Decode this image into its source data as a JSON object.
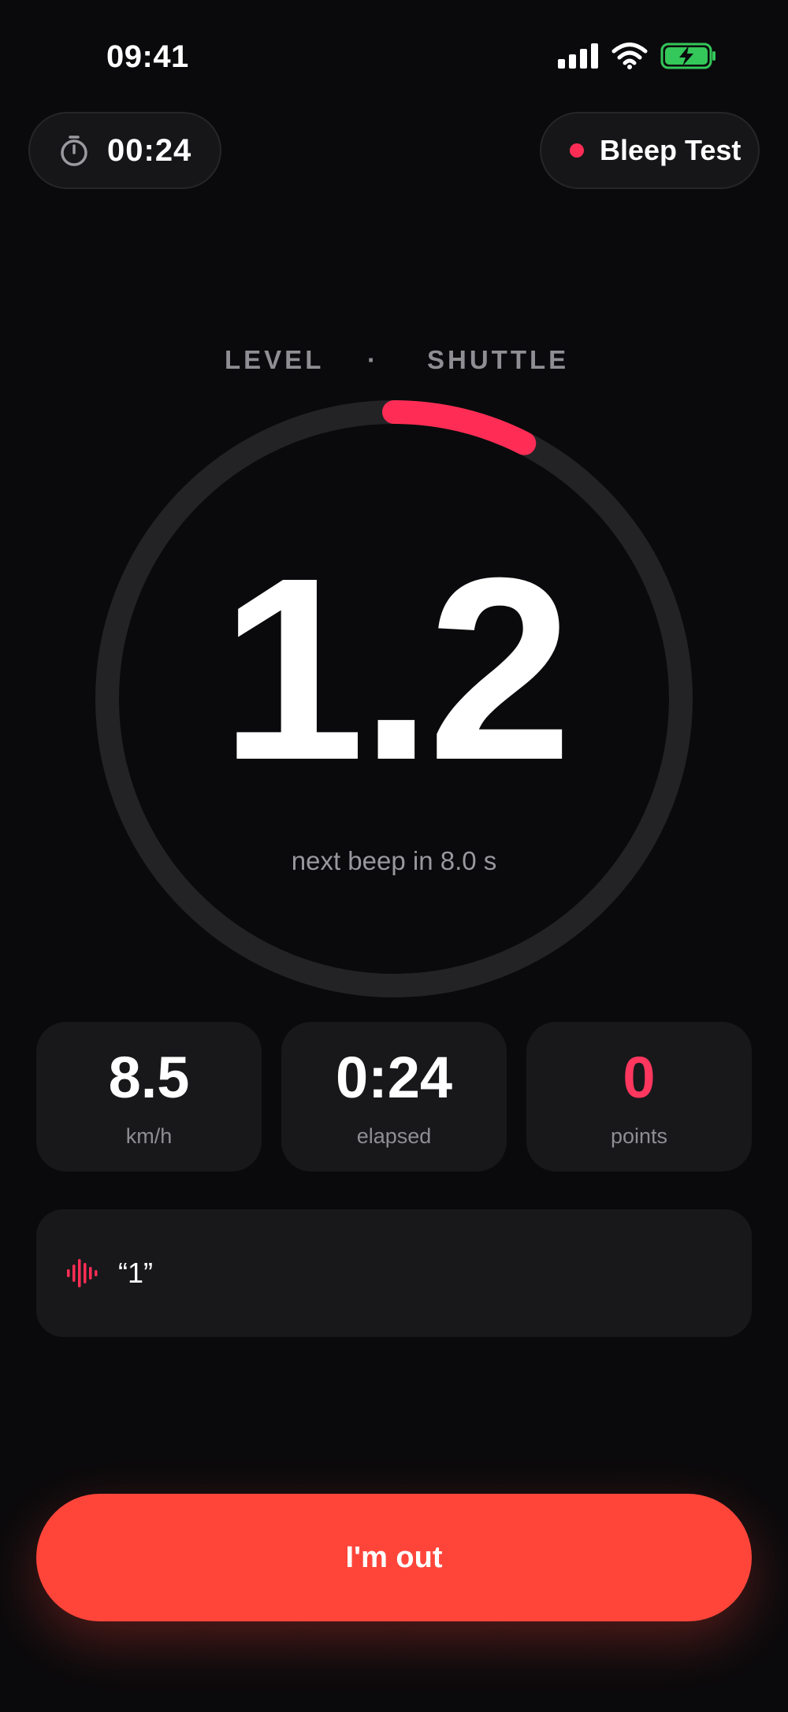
{
  "status_bar": {
    "time": "09:41"
  },
  "header": {
    "timer_value": "00:24",
    "mode_label": "Bleep Test"
  },
  "progress": {
    "level_label": "LEVEL",
    "separator": "·",
    "shuttle_label": "SHUTTLE",
    "value": "1.2",
    "next_beep_text": "next beep in 8.0 s",
    "ring_fraction": 0.075
  },
  "stats": [
    {
      "value": "8.5",
      "label": "km/h"
    },
    {
      "value": "0:24",
      "label": "elapsed"
    },
    {
      "value": "0",
      "label": "points"
    }
  ],
  "callout": {
    "text": "“1”"
  },
  "actions": {
    "out_label": "I'm out"
  },
  "colors": {
    "accent": "#ff2d55",
    "button": "#ff453a",
    "battery": "#34c759",
    "background": "#0a0a0c",
    "card": "#18181b"
  },
  "icons": {
    "timer": "stopwatch-icon",
    "signal": "cellular-signal-icon",
    "wifi": "wifi-icon",
    "battery": "battery-charging-icon",
    "callout": "waveform-icon"
  }
}
